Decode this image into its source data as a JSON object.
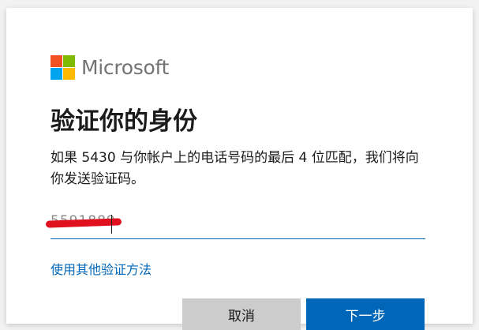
{
  "brand": {
    "name": "Microsoft",
    "logo_colors": [
      "#f25022",
      "#7fba00",
      "#00a4ef",
      "#ffb900"
    ]
  },
  "page": {
    "title": "验证你的身份",
    "description": "如果 5430 与你帐户上的电话号码的最后 4 位匹配，我们将向你发送验证码。"
  },
  "phone_input": {
    "value": "5591889",
    "redaction_color": "#e0101e"
  },
  "links": {
    "other_method": "使用其他验证方法"
  },
  "buttons": {
    "cancel": "取消",
    "next": "下一步"
  },
  "colors": {
    "accent": "#0067b8"
  }
}
